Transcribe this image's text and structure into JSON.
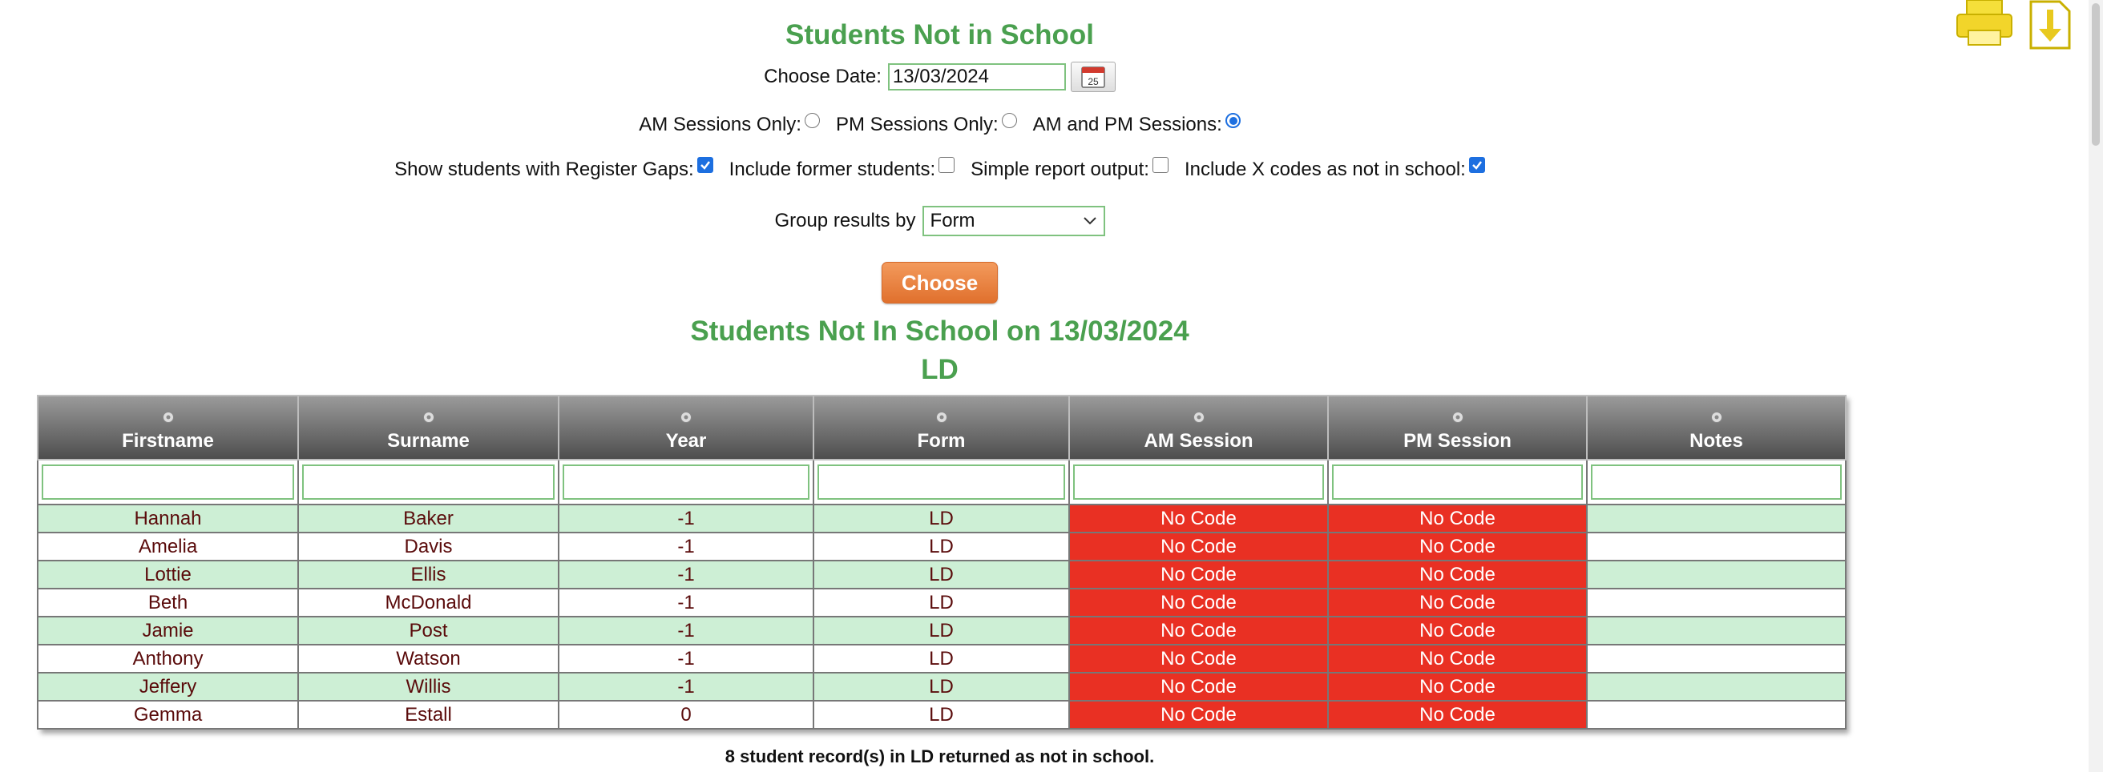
{
  "page": {
    "title": "Students Not in School",
    "subtitle": "Students Not In School on 13/03/2024",
    "group_title": "LD",
    "footer": "8 student record(s) in LD returned as not in school."
  },
  "date": {
    "label": "Choose Date:",
    "value": "13/03/2024",
    "calendar_icon": "calendar-icon",
    "calendar_text": "25"
  },
  "sessions": {
    "am_label": "AM Sessions Only:",
    "pm_label": "PM Sessions Only:",
    "both_label": "AM and PM Sessions:",
    "selected": "both"
  },
  "options": {
    "register_gaps_label": "Show students with Register Gaps:",
    "register_gaps": true,
    "former_label": "Include former students:",
    "former": false,
    "simple_label": "Simple report output:",
    "simple": false,
    "xcodes_label": "Include X codes as not in school:",
    "xcodes": true
  },
  "group": {
    "label": "Group results by",
    "value": "Form"
  },
  "choose_button": "Choose",
  "colors": {
    "accent": "#4aa04f",
    "code_bg": "#e93023",
    "row_alt": "#cdefd5",
    "button": "#e97a36"
  },
  "table": {
    "columns": [
      "Firstname",
      "Surname",
      "Year",
      "Form",
      "AM Session",
      "PM Session",
      "Notes"
    ],
    "rows": [
      [
        "Hannah",
        "Baker",
        "-1",
        "LD",
        "No Code",
        "No Code",
        ""
      ],
      [
        "Amelia",
        "Davis",
        "-1",
        "LD",
        "No Code",
        "No Code",
        ""
      ],
      [
        "Lottie",
        "Ellis",
        "-1",
        "LD",
        "No Code",
        "No Code",
        ""
      ],
      [
        "Beth",
        "McDonald",
        "-1",
        "LD",
        "No Code",
        "No Code",
        ""
      ],
      [
        "Jamie",
        "Post",
        "-1",
        "LD",
        "No Code",
        "No Code",
        ""
      ],
      [
        "Anthony",
        "Watson",
        "-1",
        "LD",
        "No Code",
        "No Code",
        ""
      ],
      [
        "Jeffery",
        "Willis",
        "-1",
        "LD",
        "No Code",
        "No Code",
        ""
      ],
      [
        "Gemma",
        "Estall",
        "0",
        "LD",
        "No Code",
        "No Code",
        ""
      ]
    ]
  },
  "icons": {
    "print": "printer-icon",
    "export": "download-icon"
  }
}
